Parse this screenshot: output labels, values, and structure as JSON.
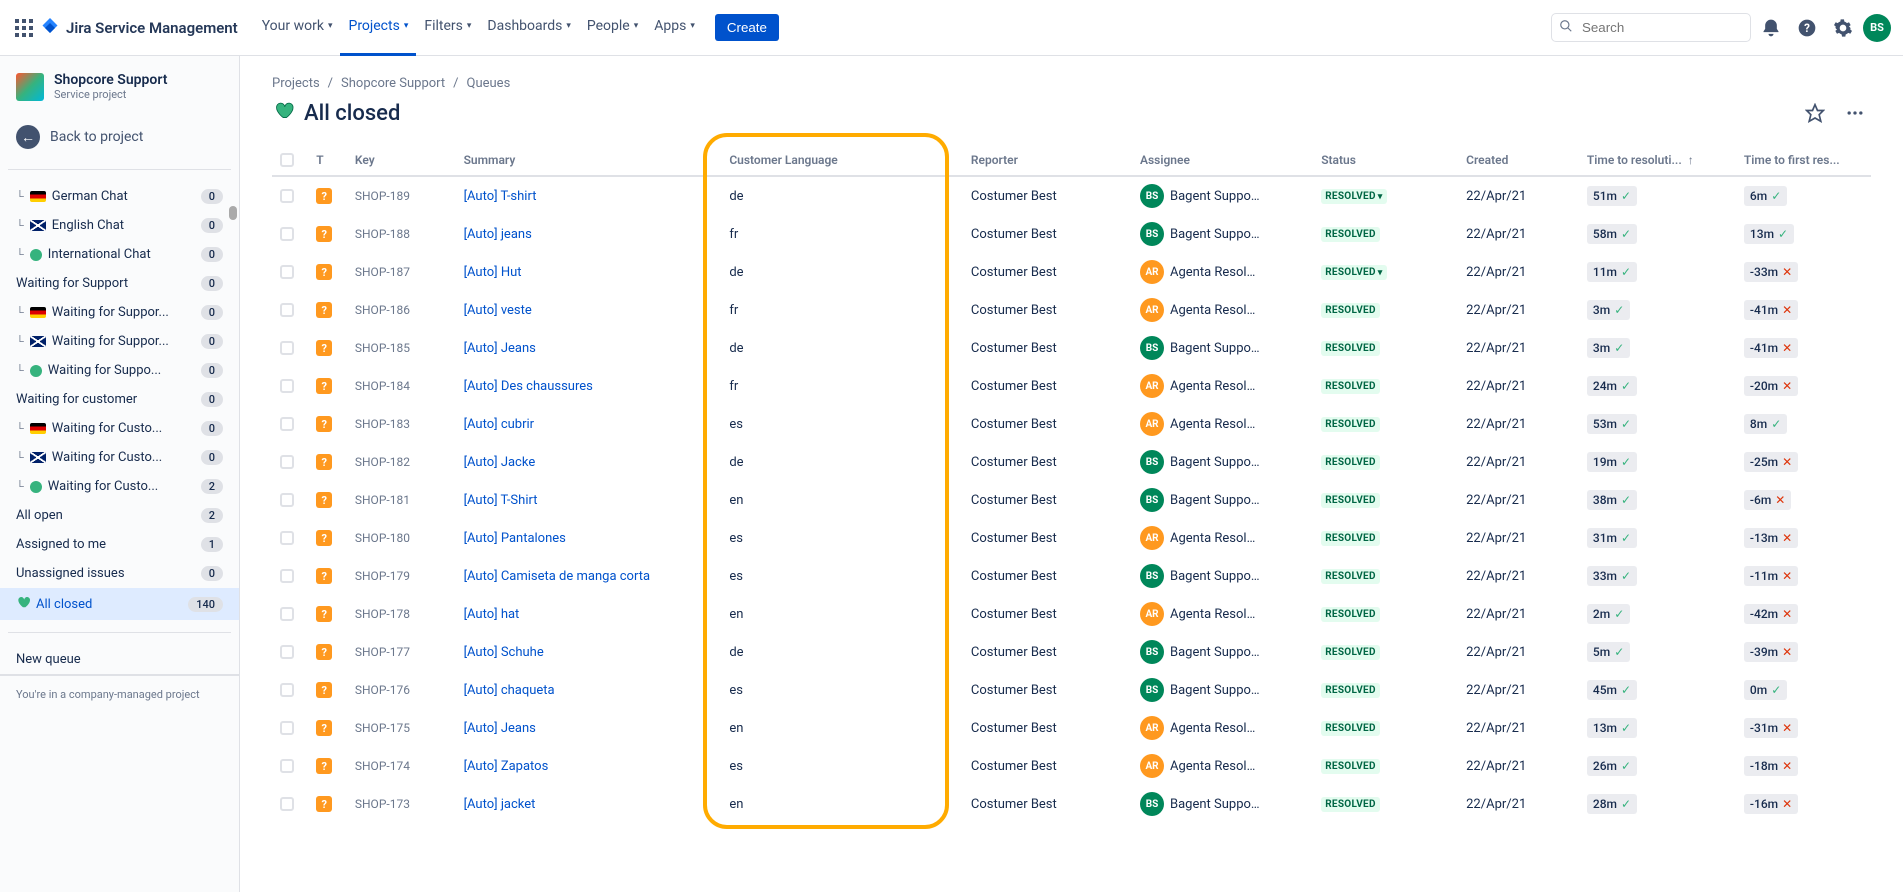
{
  "topnav": {
    "product": "Jira Service Management",
    "items": [
      "Your work",
      "Projects",
      "Filters",
      "Dashboards",
      "People",
      "Apps"
    ],
    "active_index": 1,
    "create": "Create",
    "search_placeholder": "Search"
  },
  "user_avatar": "BS",
  "sidebar": {
    "project_name": "Shopcore Support",
    "project_type": "Service project",
    "back": "Back to project",
    "queues": [
      {
        "label": "German Chat",
        "flag": "de",
        "count": "0",
        "indent": true
      },
      {
        "label": "English Chat",
        "flag": "uk",
        "count": "0",
        "indent": true
      },
      {
        "label": "International Chat",
        "flag": "intl",
        "count": "0",
        "indent": true
      },
      {
        "label": "Waiting for Support",
        "count": "0"
      },
      {
        "label": "Waiting for Suppor...",
        "flag": "de",
        "count": "0",
        "indent": true
      },
      {
        "label": "Waiting for Suppor...",
        "flag": "uk",
        "count": "0",
        "indent": true
      },
      {
        "label": "Waiting for Suppo...",
        "flag": "intl",
        "count": "0",
        "indent": true
      },
      {
        "label": "Waiting for customer",
        "count": "0"
      },
      {
        "label": "Waiting for Custo...",
        "flag": "de",
        "count": "0",
        "indent": true
      },
      {
        "label": "Waiting for Custo...",
        "flag": "uk",
        "count": "0",
        "indent": true
      },
      {
        "label": "Waiting for Custo...",
        "flag": "intl",
        "count": "2",
        "indent": true
      },
      {
        "label": "All open",
        "count": "2"
      },
      {
        "label": "Assigned to me",
        "count": "1"
      },
      {
        "label": "Unassigned issues",
        "count": "0"
      },
      {
        "label": "All closed",
        "count": "140",
        "heart": true,
        "active": true
      }
    ],
    "new_queue": "New queue",
    "footer": "You're in a company-managed project"
  },
  "breadcrumb": [
    "Projects",
    "Shopcore Support",
    "Queues"
  ],
  "page_title": "All closed",
  "columns": {
    "type": "T",
    "key": "Key",
    "summary": "Summary",
    "lang": "Customer Language",
    "reporter": "Reporter",
    "assignee": "Assignee",
    "status": "Status",
    "created": "Created",
    "ttr": "Time to resoluti...",
    "ttfr": "Time to first res..."
  },
  "rows": [
    {
      "key": "SHOP-189",
      "summary": "[Auto] T-shirt",
      "lang": "de",
      "reporter": "Costumer Best",
      "assignee": "Bagent Suppor...",
      "av": "BS",
      "avc": "green",
      "status": "RESOLVED",
      "status_chev": true,
      "created": "22/Apr/21",
      "ttr": "51m",
      "ttr_ok": true,
      "ttfr": "6m",
      "ttfr_ok": true
    },
    {
      "key": "SHOP-188",
      "summary": "[Auto] jeans",
      "lang": "fr",
      "reporter": "Costumer Best",
      "assignee": "Bagent Suppor...",
      "av": "BS",
      "avc": "green",
      "status": "RESOLVED",
      "created": "22/Apr/21",
      "ttr": "58m",
      "ttr_ok": true,
      "ttfr": "13m",
      "ttfr_ok": true
    },
    {
      "key": "SHOP-187",
      "summary": "[Auto] Hut",
      "lang": "de",
      "reporter": "Costumer Best",
      "assignee": "Agenta Resolut...",
      "av": "AR",
      "avc": "orange",
      "status": "RESOLVED",
      "status_chev": true,
      "created": "22/Apr/21",
      "ttr": "11m",
      "ttr_ok": true,
      "ttfr": "-33m",
      "ttfr_ok": false
    },
    {
      "key": "SHOP-186",
      "summary": "[Auto] veste",
      "lang": "fr",
      "reporter": "Costumer Best",
      "assignee": "Agenta Resolut...",
      "av": "AR",
      "avc": "orange",
      "status": "RESOLVED",
      "created": "22/Apr/21",
      "ttr": "3m",
      "ttr_ok": true,
      "ttfr": "-41m",
      "ttfr_ok": false
    },
    {
      "key": "SHOP-185",
      "summary": "[Auto] Jeans",
      "lang": "de",
      "reporter": "Costumer Best",
      "assignee": "Bagent Suppor...",
      "av": "BS",
      "avc": "green",
      "status": "RESOLVED",
      "created": "22/Apr/21",
      "ttr": "3m",
      "ttr_ok": true,
      "ttfr": "-41m",
      "ttfr_ok": false
    },
    {
      "key": "SHOP-184",
      "summary": "[Auto] Des chaussures",
      "lang": "fr",
      "reporter": "Costumer Best",
      "assignee": "Agenta Resolut...",
      "av": "AR",
      "avc": "orange",
      "status": "RESOLVED",
      "created": "22/Apr/21",
      "ttr": "24m",
      "ttr_ok": true,
      "ttfr": "-20m",
      "ttfr_ok": false
    },
    {
      "key": "SHOP-183",
      "summary": "[Auto] cubrir",
      "lang": "es",
      "reporter": "Costumer Best",
      "assignee": "Agenta Resolut...",
      "av": "AR",
      "avc": "orange",
      "status": "RESOLVED",
      "created": "22/Apr/21",
      "ttr": "53m",
      "ttr_ok": true,
      "ttfr": "8m",
      "ttfr_ok": true
    },
    {
      "key": "SHOP-182",
      "summary": "[Auto] Jacke",
      "lang": "de",
      "reporter": "Costumer Best",
      "assignee": "Bagent Suppor...",
      "av": "BS",
      "avc": "green",
      "status": "RESOLVED",
      "created": "22/Apr/21",
      "ttr": "19m",
      "ttr_ok": true,
      "ttfr": "-25m",
      "ttfr_ok": false
    },
    {
      "key": "SHOP-181",
      "summary": "[Auto] T-Shirt",
      "lang": "en",
      "reporter": "Costumer Best",
      "assignee": "Bagent Suppor...",
      "av": "BS",
      "avc": "green",
      "status": "RESOLVED",
      "created": "22/Apr/21",
      "ttr": "38m",
      "ttr_ok": true,
      "ttfr": "-6m",
      "ttfr_ok": false
    },
    {
      "key": "SHOP-180",
      "summary": "[Auto] Pantalones",
      "lang": "es",
      "reporter": "Costumer Best",
      "assignee": "Agenta Resolut...",
      "av": "AR",
      "avc": "orange",
      "status": "RESOLVED",
      "created": "22/Apr/21",
      "ttr": "31m",
      "ttr_ok": true,
      "ttfr": "-13m",
      "ttfr_ok": false
    },
    {
      "key": "SHOP-179",
      "summary": "[Auto] Camiseta de manga corta",
      "lang": "es",
      "reporter": "Costumer Best",
      "assignee": "Bagent Suppor...",
      "av": "BS",
      "avc": "green",
      "status": "RESOLVED",
      "created": "22/Apr/21",
      "ttr": "33m",
      "ttr_ok": true,
      "ttfr": "-11m",
      "ttfr_ok": false
    },
    {
      "key": "SHOP-178",
      "summary": "[Auto] hat",
      "lang": "en",
      "reporter": "Costumer Best",
      "assignee": "Agenta Resolut...",
      "av": "AR",
      "avc": "orange",
      "status": "RESOLVED",
      "created": "22/Apr/21",
      "ttr": "2m",
      "ttr_ok": true,
      "ttfr": "-42m",
      "ttfr_ok": false
    },
    {
      "key": "SHOP-177",
      "summary": "[Auto] Schuhe",
      "lang": "de",
      "reporter": "Costumer Best",
      "assignee": "Bagent Suppor...",
      "av": "BS",
      "avc": "green",
      "status": "RESOLVED",
      "created": "22/Apr/21",
      "ttr": "5m",
      "ttr_ok": true,
      "ttfr": "-39m",
      "ttfr_ok": false
    },
    {
      "key": "SHOP-176",
      "summary": "[Auto] chaqueta",
      "lang": "es",
      "reporter": "Costumer Best",
      "assignee": "Bagent Suppor...",
      "av": "BS",
      "avc": "green",
      "status": "RESOLVED",
      "created": "22/Apr/21",
      "ttr": "45m",
      "ttr_ok": true,
      "ttfr": "0m",
      "ttfr_ok": true
    },
    {
      "key": "SHOP-175",
      "summary": "[Auto] Jeans",
      "lang": "en",
      "reporter": "Costumer Best",
      "assignee": "Agenta Resolut...",
      "av": "AR",
      "avc": "orange",
      "status": "RESOLVED",
      "created": "22/Apr/21",
      "ttr": "13m",
      "ttr_ok": true,
      "ttfr": "-31m",
      "ttfr_ok": false
    },
    {
      "key": "SHOP-174",
      "summary": "[Auto] Zapatos",
      "lang": "es",
      "reporter": "Costumer Best",
      "assignee": "Agenta Resolut...",
      "av": "AR",
      "avc": "orange",
      "status": "RESOLVED",
      "created": "22/Apr/21",
      "ttr": "26m",
      "ttr_ok": true,
      "ttfr": "-18m",
      "ttfr_ok": false
    },
    {
      "key": "SHOP-173",
      "summary": "[Auto] jacket",
      "lang": "en",
      "reporter": "Costumer Best",
      "assignee": "Bagent Suppor...",
      "av": "BS",
      "avc": "green",
      "status": "RESOLVED",
      "created": "22/Apr/21",
      "ttr": "28m",
      "ttr_ok": true,
      "ttfr": "-16m",
      "ttfr_ok": false
    }
  ]
}
